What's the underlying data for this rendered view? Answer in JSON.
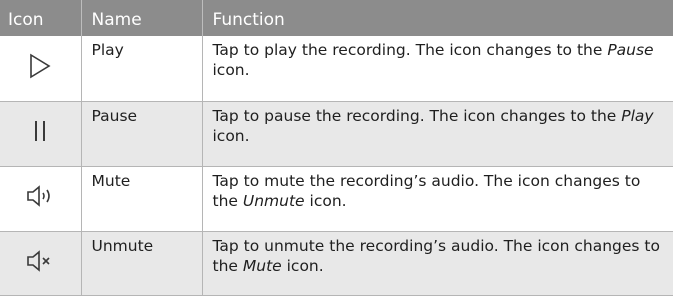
{
  "header": {
    "icon": "Icon",
    "name": "Name",
    "function": "Function"
  },
  "rows": [
    {
      "icon": "play-icon",
      "name": "Play",
      "function_before": "Tap to play the recording. The icon changes to the ",
      "function_em": "Pause",
      "function_after": " icon."
    },
    {
      "icon": "pause-icon",
      "name": "Pause",
      "function_before": "Tap to pause the recording. The icon changes to the ",
      "function_em": "Play",
      "function_after": " icon."
    },
    {
      "icon": "mute-icon",
      "name": "Mute",
      "function_before": "Tap to mute the recording’s audio. The icon changes to the ",
      "function_em": "Unmute",
      "function_after": " icon."
    },
    {
      "icon": "unmute-icon",
      "name": "Unmute",
      "function_before": "Tap to unmute the recording’s audio. The icon changes to the ",
      "function_em": "Mute",
      "function_after": " icon."
    }
  ],
  "colors": {
    "header_bg": "#8c8c8c",
    "alt_row_bg": "#e8e8e8",
    "icon_stroke": "#3a3a3a"
  }
}
